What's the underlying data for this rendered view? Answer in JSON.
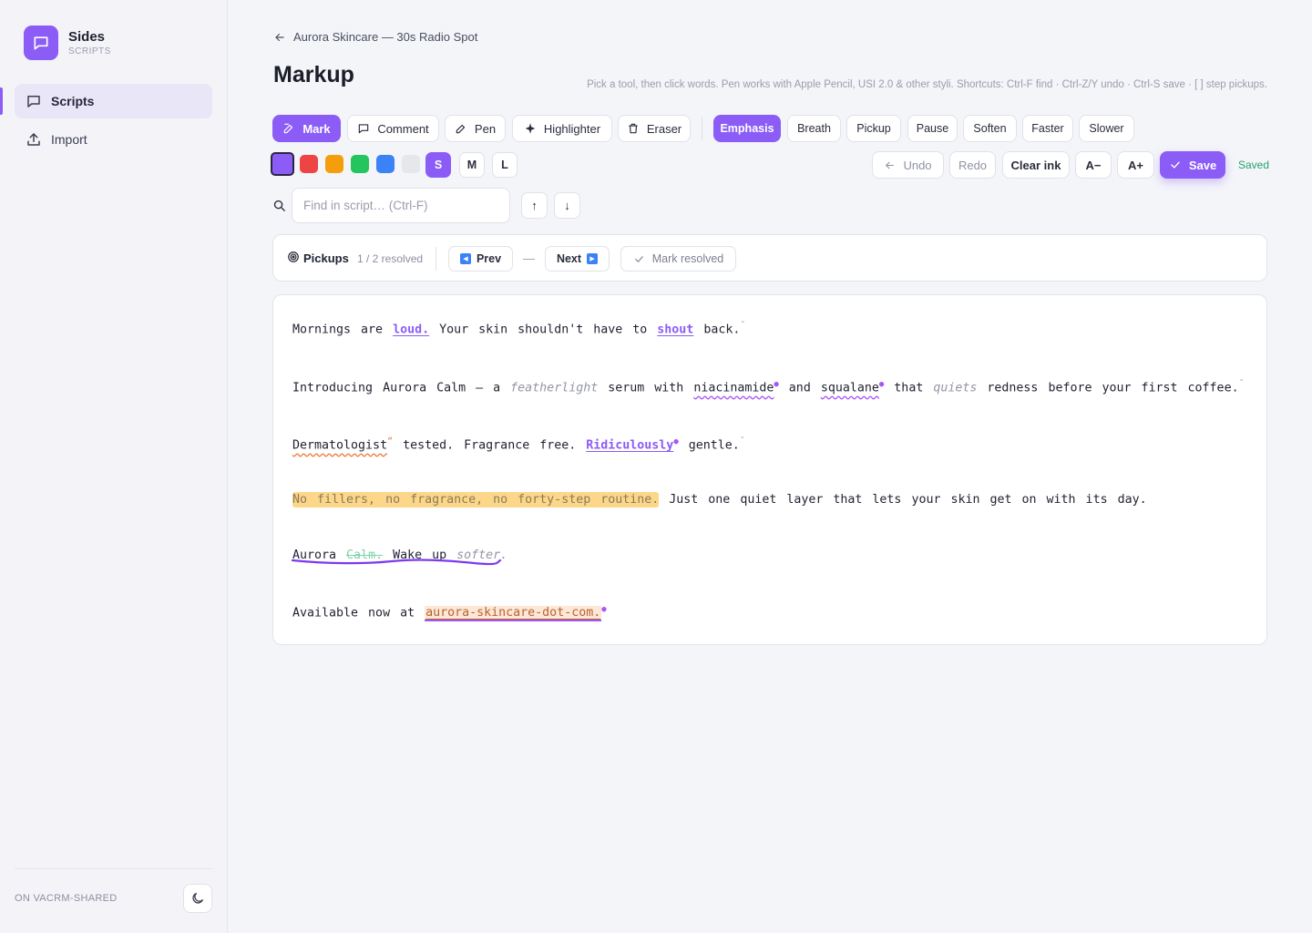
{
  "sidebar": {
    "brand_title": "Sides",
    "brand_sub": "SCRIPTS",
    "items": [
      {
        "label": "Scripts",
        "icon": "chat-icon",
        "active": true
      },
      {
        "label": "Import",
        "icon": "upload-icon",
        "active": false
      }
    ],
    "footer": "ON VACRM-SHARED",
    "theme_icon": "moon-icon"
  },
  "header": {
    "breadcrumb": "Aurora Skincare — 30s Radio Spot",
    "title": "Markup",
    "hint": "Pick a tool, then click words. Pen works with Apple Pencil, USI 2.0 & other styli. Shortcuts: Ctrl-F find · Ctrl-Z/Y undo · Ctrl-S save · [ ] step pickups."
  },
  "tools": {
    "mark": "Mark",
    "comment": "Comment",
    "pen": "Pen",
    "highlighter": "Highlighter",
    "eraser": "Eraser"
  },
  "marks": {
    "emphasis": "Emphasis",
    "breath": "Breath",
    "pickup": "Pickup",
    "pause": "Pause",
    "soften": "Soften",
    "faster": "Faster",
    "slower": "Slower"
  },
  "colors": [
    "#8b5cf6",
    "#ef4444",
    "#f59e0b",
    "#22c55e",
    "#3b82f6",
    "#e5e7eb"
  ],
  "sizes": {
    "s": "S",
    "m": "M",
    "l": "L",
    "active": "S"
  },
  "actions": {
    "undo": "Undo",
    "redo": "Redo",
    "clear_ink": "Clear ink",
    "font_down": "A−",
    "font_up": "A+",
    "save": "Save",
    "status": "Saved"
  },
  "search": {
    "placeholder": "Find in script… (Ctrl-F)",
    "up": "↑",
    "down": "↓"
  },
  "pickups": {
    "title": "Pickups",
    "count": "1 / 2 resolved",
    "prev": "Prev",
    "dash": "—",
    "next": "Next",
    "resolve": "Mark resolved"
  },
  "script": {
    "l1": {
      "a": "Mornings are ",
      "b": "loud.",
      "c": " Your skin shouldn't have to ",
      "d": "shout",
      "e": " back."
    },
    "l2": {
      "a": "Introducing Aurora Calm — a ",
      "b": "featherlight",
      "c": " serum with ",
      "d": "niacinamide",
      "e": " and ",
      "f": "squalane",
      "g": " that ",
      "h": "quiets",
      "i": " redness before your first coffee."
    },
    "l3": {
      "a": "Dermatologist",
      "b": " tested. Fragrance free. ",
      "c": "Ridiculously",
      "d": " gentle."
    },
    "l4": {
      "a": "No fillers, no fragrance, no forty-step routine.",
      "b": " Just one quiet layer that lets your skin get on with its day."
    },
    "l5": {
      "a": "Aurora ",
      "b": "Calm.",
      "c": " Wake up ",
      "d": "softer."
    },
    "l6": {
      "a": "Available now at ",
      "b": "aurora-skincare-dot-com."
    }
  }
}
